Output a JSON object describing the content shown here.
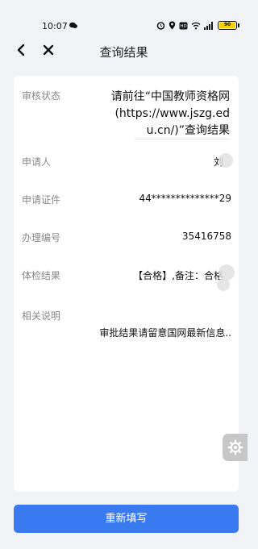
{
  "status_bar": {
    "time": "10:07",
    "battery": "90"
  },
  "nav": {
    "title": "查询结果"
  },
  "result": {
    "status_label": "审核状态",
    "status_value": "请前往“中国教师资格网(https://www.jszg.edu.cn/)”查询结果",
    "applicant_label": "申请人",
    "applicant_value": "刘",
    "id_label": "申请证件",
    "id_value": "44**************29",
    "number_label": "办理编号",
    "number_value": "35416758",
    "health_label": "体检结果",
    "health_value": "【合格】,备注：合格",
    "note_label": "相关说明",
    "note_value": "审批结果请留意国网最新信息.."
  },
  "actions": {
    "refill_label": "重新填写"
  },
  "colors": {
    "primary": "#3a7af0",
    "background": "#f2f3f7",
    "label": "#8a8a8a"
  }
}
